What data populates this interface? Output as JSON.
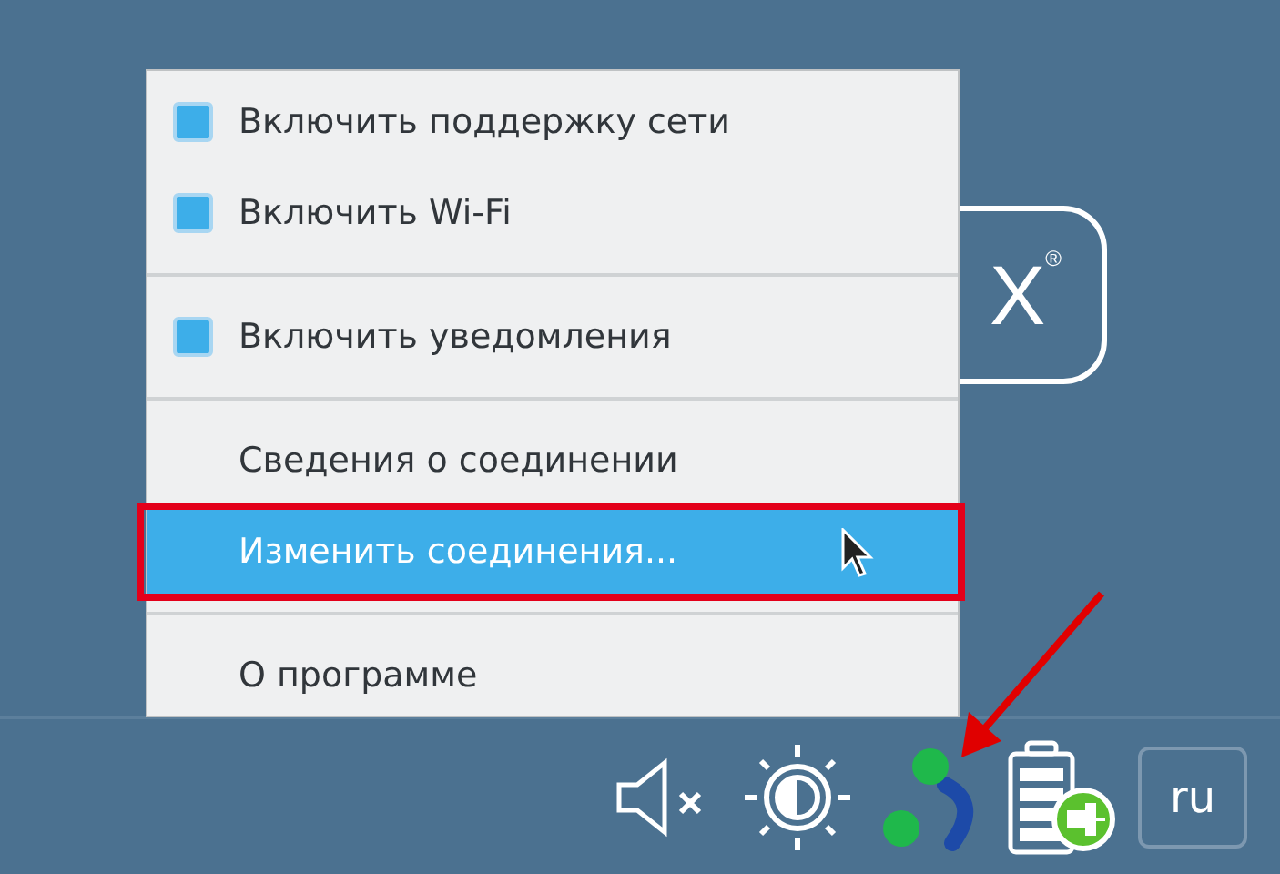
{
  "logo": {
    "text": "X$^{®}$"
  },
  "menu": {
    "items": [
      {
        "kind": "checkbox",
        "label": "Включить поддержку сети",
        "checked": true,
        "selected": false
      },
      {
        "kind": "checkbox",
        "label": "Включить Wi-Fi",
        "checked": true,
        "selected": false
      },
      {
        "kind": "separator"
      },
      {
        "kind": "checkbox",
        "label": "Включить уведомления",
        "checked": true,
        "selected": false
      },
      {
        "kind": "separator"
      },
      {
        "kind": "action",
        "label": "Сведения о соединении",
        "selected": false
      },
      {
        "kind": "action",
        "label": "Изменить соединения...",
        "selected": true
      },
      {
        "kind": "separator"
      },
      {
        "kind": "action",
        "label": "О программе",
        "selected": false
      }
    ]
  },
  "panel": {
    "speaker_muted": true,
    "keyboard_layout": "ru"
  }
}
